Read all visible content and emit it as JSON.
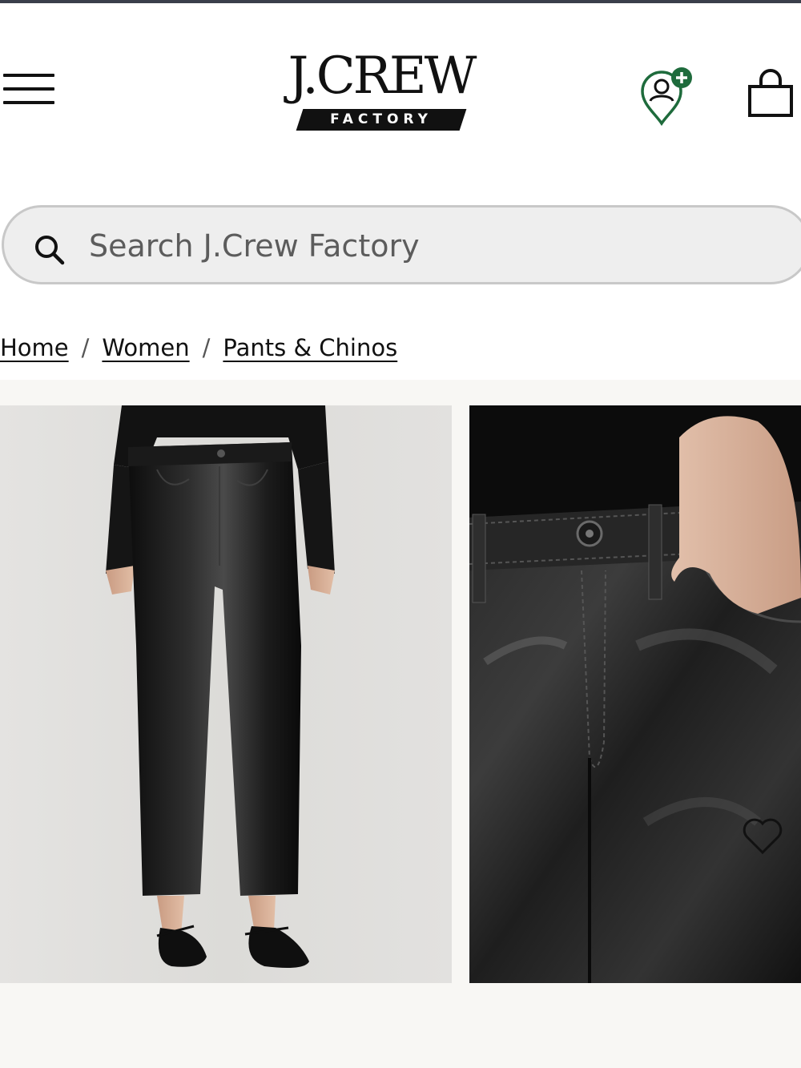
{
  "header": {
    "brand_name": "J.CREW",
    "brand_sub": "FACTORY",
    "icons": {
      "menu": "hamburger-menu-icon",
      "account": "account-location-plus-icon",
      "bag": "shopping-bag-icon"
    },
    "accent_color": "#1e6b3c"
  },
  "search": {
    "placeholder": "Search J.Crew Factory",
    "icon": "search-icon"
  },
  "breadcrumb": {
    "items": [
      "Home",
      "Women",
      "Pants & Chinos"
    ],
    "separator": "/"
  },
  "gallery": {
    "images": [
      {
        "alt": "Faux-leather kick-out crop pants, full length view"
      },
      {
        "alt": "Faux-leather pants, waistband detail view"
      }
    ],
    "wishlist_icon": "heart-icon"
  }
}
